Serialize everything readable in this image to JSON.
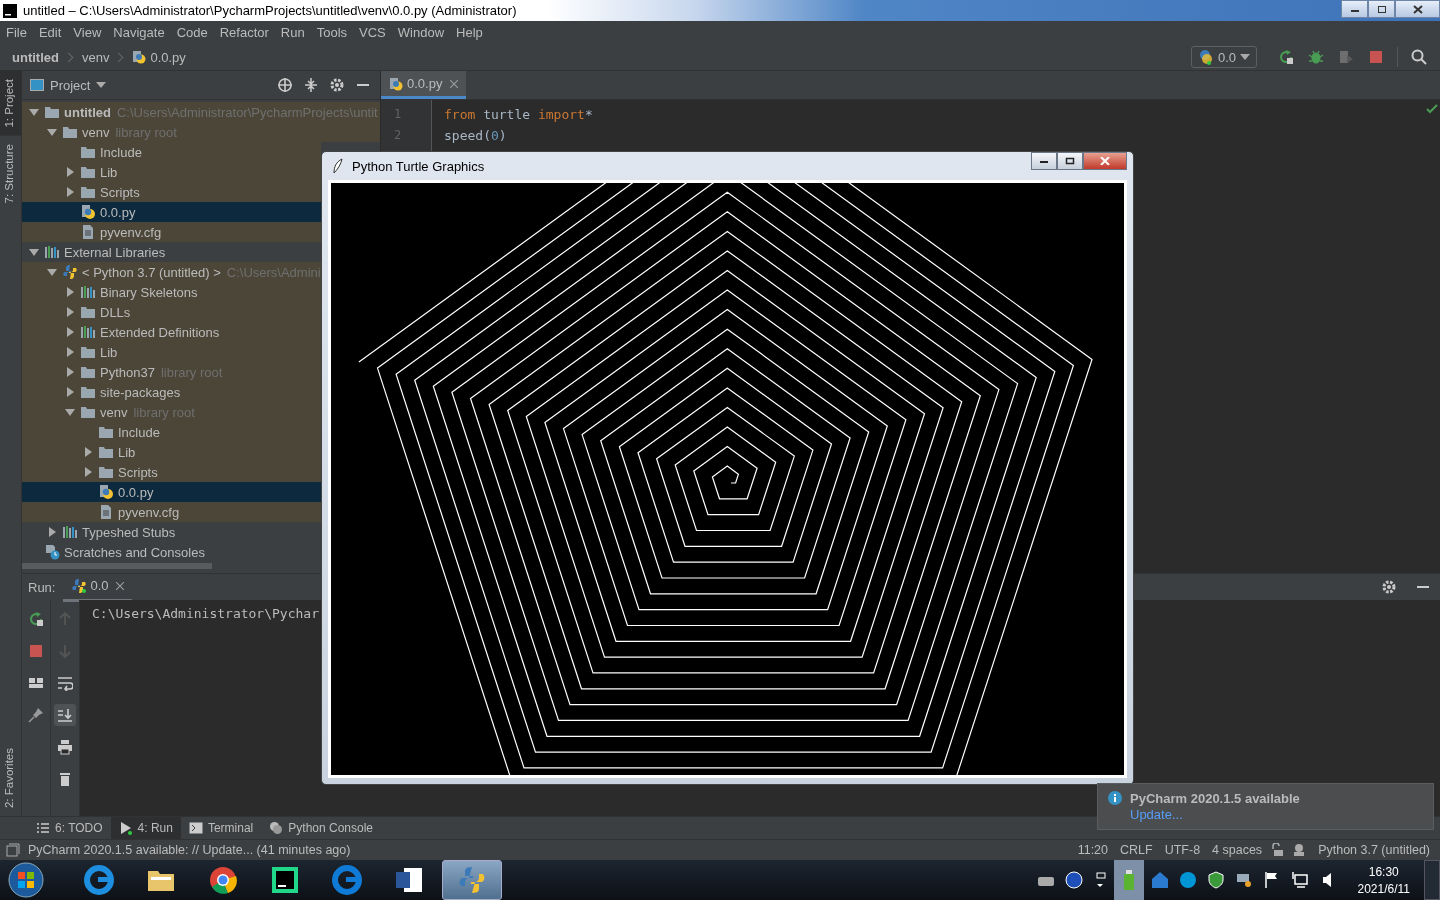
{
  "title_bar": {
    "title": "untitled – C:\\Users\\Administrator\\PycharmProjects\\untitled\\venv\\0.0.py (Administrator)"
  },
  "menu": [
    "File",
    "Edit",
    "View",
    "Navigate",
    "Code",
    "Refactor",
    "Run",
    "Tools",
    "VCS",
    "Window",
    "Help"
  ],
  "breadcrumbs": [
    "untitled",
    "venv",
    "0.0.py"
  ],
  "run_config": {
    "label": "0.0"
  },
  "side_tabs_top": [
    {
      "label": "1: Project",
      "selected": true
    },
    {
      "label": "7: Structure",
      "selected": false
    }
  ],
  "side_tabs_bottom": [
    {
      "label": "2: Favorites",
      "selected": false
    }
  ],
  "project_panel": {
    "title": "Project",
    "tree": [
      {
        "label": "untitled",
        "kind": "project",
        "hint": "C:\\Users\\Administrator\\PycharmProjects\\untit",
        "expanded": true,
        "selected": false,
        "tinted": true,
        "children": [
          {
            "label": "venv",
            "kind": "folder",
            "hint": "library root",
            "expanded": true,
            "selected": false,
            "tinted": true,
            "children": [
              {
                "label": "Include",
                "kind": "folder",
                "selected": false,
                "tinted": true
              },
              {
                "label": "Lib",
                "kind": "folder",
                "expanded": false,
                "selected": false,
                "tinted": true
              },
              {
                "label": "Scripts",
                "kind": "folder",
                "expanded": false,
                "selected": false,
                "tinted": true
              },
              {
                "label": "0.0.py",
                "kind": "pyfile",
                "selected": true,
                "tinted": true
              },
              {
                "label": "pyvenv.cfg",
                "kind": "file",
                "selected": false,
                "tinted": true
              }
            ]
          }
        ]
      },
      {
        "label": "External Libraries",
        "kind": "library",
        "expanded": true,
        "selected": false,
        "tinted": false,
        "children": [
          {
            "label": "< Python 3.7 (untitled) >",
            "kind": "python",
            "hint": "C:\\Users\\Admini",
            "expanded": true,
            "selected": false,
            "tinted": true,
            "children": [
              {
                "label": "Binary Skeletons",
                "kind": "library",
                "expanded": false,
                "selected": false,
                "tinted": true
              },
              {
                "label": "DLLs",
                "kind": "folder",
                "expanded": false,
                "selected": false,
                "tinted": true
              },
              {
                "label": "Extended Definitions",
                "kind": "library",
                "expanded": false,
                "selected": false,
                "tinted": true
              },
              {
                "label": "Lib",
                "kind": "folder",
                "expanded": false,
                "selected": false,
                "tinted": true
              },
              {
                "label": "Python37",
                "kind": "folder",
                "hint": "library root",
                "expanded": false,
                "selected": false,
                "tinted": true
              },
              {
                "label": "site-packages",
                "kind": "folder",
                "expanded": false,
                "selected": false,
                "tinted": true
              },
              {
                "label": "venv",
                "kind": "folder",
                "hint": "library root",
                "expanded": true,
                "selected": false,
                "tinted": true,
                "children": [
                  {
                    "label": "Include",
                    "kind": "folder",
                    "selected": false,
                    "tinted": true
                  },
                  {
                    "label": "Lib",
                    "kind": "folder",
                    "expanded": false,
                    "selected": false,
                    "tinted": true
                  },
                  {
                    "label": "Scripts",
                    "kind": "folder",
                    "expanded": false,
                    "selected": false,
                    "tinted": true
                  },
                  {
                    "label": "0.0.py",
                    "kind": "pyfile",
                    "selected": true,
                    "tinted": true
                  },
                  {
                    "label": "pyvenv.cfg",
                    "kind": "file",
                    "selected": false,
                    "tinted": true
                  }
                ]
              }
            ]
          },
          {
            "label": "Typeshed Stubs",
            "kind": "library",
            "expanded": false,
            "selected": false,
            "tinted": false
          }
        ]
      },
      {
        "label": "Scratches and Consoles",
        "kind": "scratches",
        "selected": false,
        "tinted": false
      }
    ]
  },
  "editor": {
    "tabs": [
      {
        "label": "0.0.py",
        "selected": true
      }
    ],
    "lines": [
      {
        "number": "1",
        "tokens": [
          {
            "kind": "keyword",
            "text": "from"
          },
          {
            "kind": "plain",
            "text": " turtle "
          },
          {
            "kind": "keyword",
            "text": "import"
          },
          {
            "kind": "plain",
            "text": "*"
          }
        ]
      },
      {
        "number": "2",
        "tokens": [
          {
            "kind": "plain",
            "text": "speed("
          },
          {
            "kind": "number",
            "text": "0"
          },
          {
            "kind": "plain",
            "text": ")"
          }
        ]
      }
    ]
  },
  "run_panel": {
    "label": "Run:",
    "tabs": [
      {
        "label": "0.0",
        "selected": true
      }
    ],
    "output": [
      "C:\\Users\\Administrator\\Pychar"
    ]
  },
  "tool_tabs": [
    {
      "label": "6: TODO",
      "kind": "list",
      "selected": false
    },
    {
      "label": "4: Run",
      "kind": "run",
      "selected": true
    },
    {
      "label": "Terminal",
      "kind": "terminal",
      "selected": false
    },
    {
      "label": "Python Console",
      "kind": "python",
      "selected": false
    }
  ],
  "status_bar": {
    "message": "PyCharm 2020.1.5 available: // Update... (41 minutes ago)",
    "items": [
      "11:20",
      "CRLF",
      "UTF-8",
      "4 spaces"
    ],
    "interpreter": "Python 3.7 (untitled)"
  },
  "notification": {
    "title": "PyCharm 2020.1.5 available",
    "link": "Update..."
  },
  "turtle_window": {
    "title": "Python Turtle Graphics"
  },
  "taskbar": {
    "apps": [
      {
        "kind": "ie",
        "selected": false
      },
      {
        "kind": "explorer",
        "selected": false
      },
      {
        "kind": "chrome",
        "selected": false
      },
      {
        "kind": "pycharm",
        "selected": false
      },
      {
        "kind": "edge",
        "selected": false
      },
      {
        "kind": "word",
        "selected": false
      },
      {
        "kind": "python",
        "selected": true
      }
    ],
    "time": "16:30",
    "date": "2021/6/11"
  }
}
